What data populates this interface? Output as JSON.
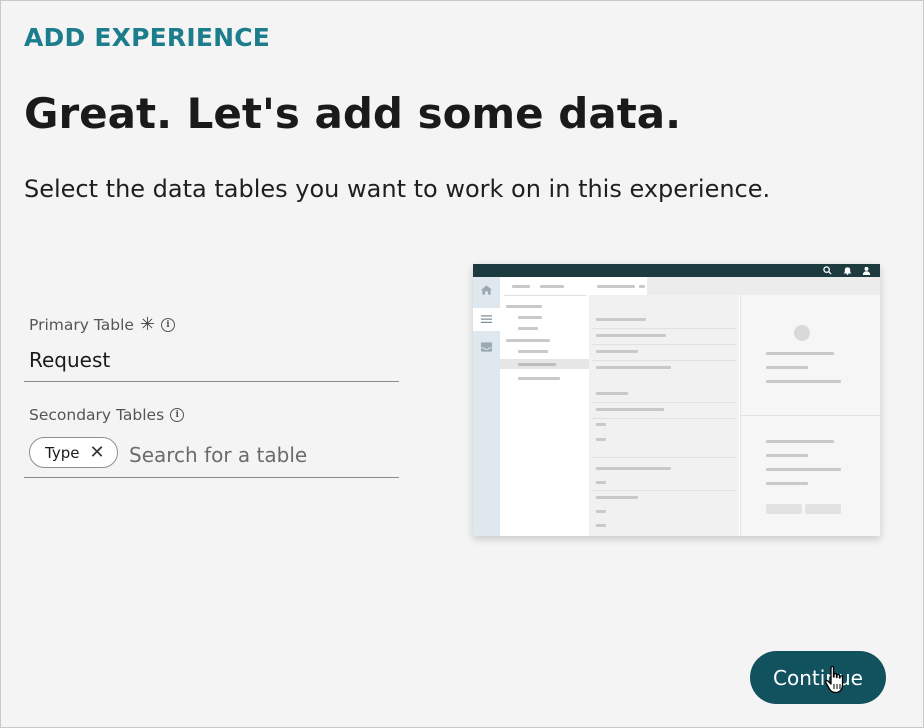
{
  "header": {
    "eyebrow": "ADD EXPERIENCE",
    "title": "Great. Let's add some data.",
    "subtitle": "Select the data tables you want to work on in this experience."
  },
  "form": {
    "primary_table": {
      "label": "Primary Table",
      "required_marker": "✳",
      "value": "Request"
    },
    "secondary_tables": {
      "label": "Secondary Tables",
      "chips": [
        "Type"
      ],
      "chip_remove_glyph": "✕",
      "placeholder": "Search for a table",
      "value": ""
    }
  },
  "footer": {
    "continue_label": "Continue"
  },
  "colors": {
    "accent_teal": "#1c7d8c",
    "button_bg": "#12525e",
    "background": "#f4f4f4"
  },
  "icons": {
    "info": "info-circle-icon",
    "required": "asterisk-icon",
    "remove_chip": "close-icon",
    "cursor": "hand-pointer-icon"
  }
}
